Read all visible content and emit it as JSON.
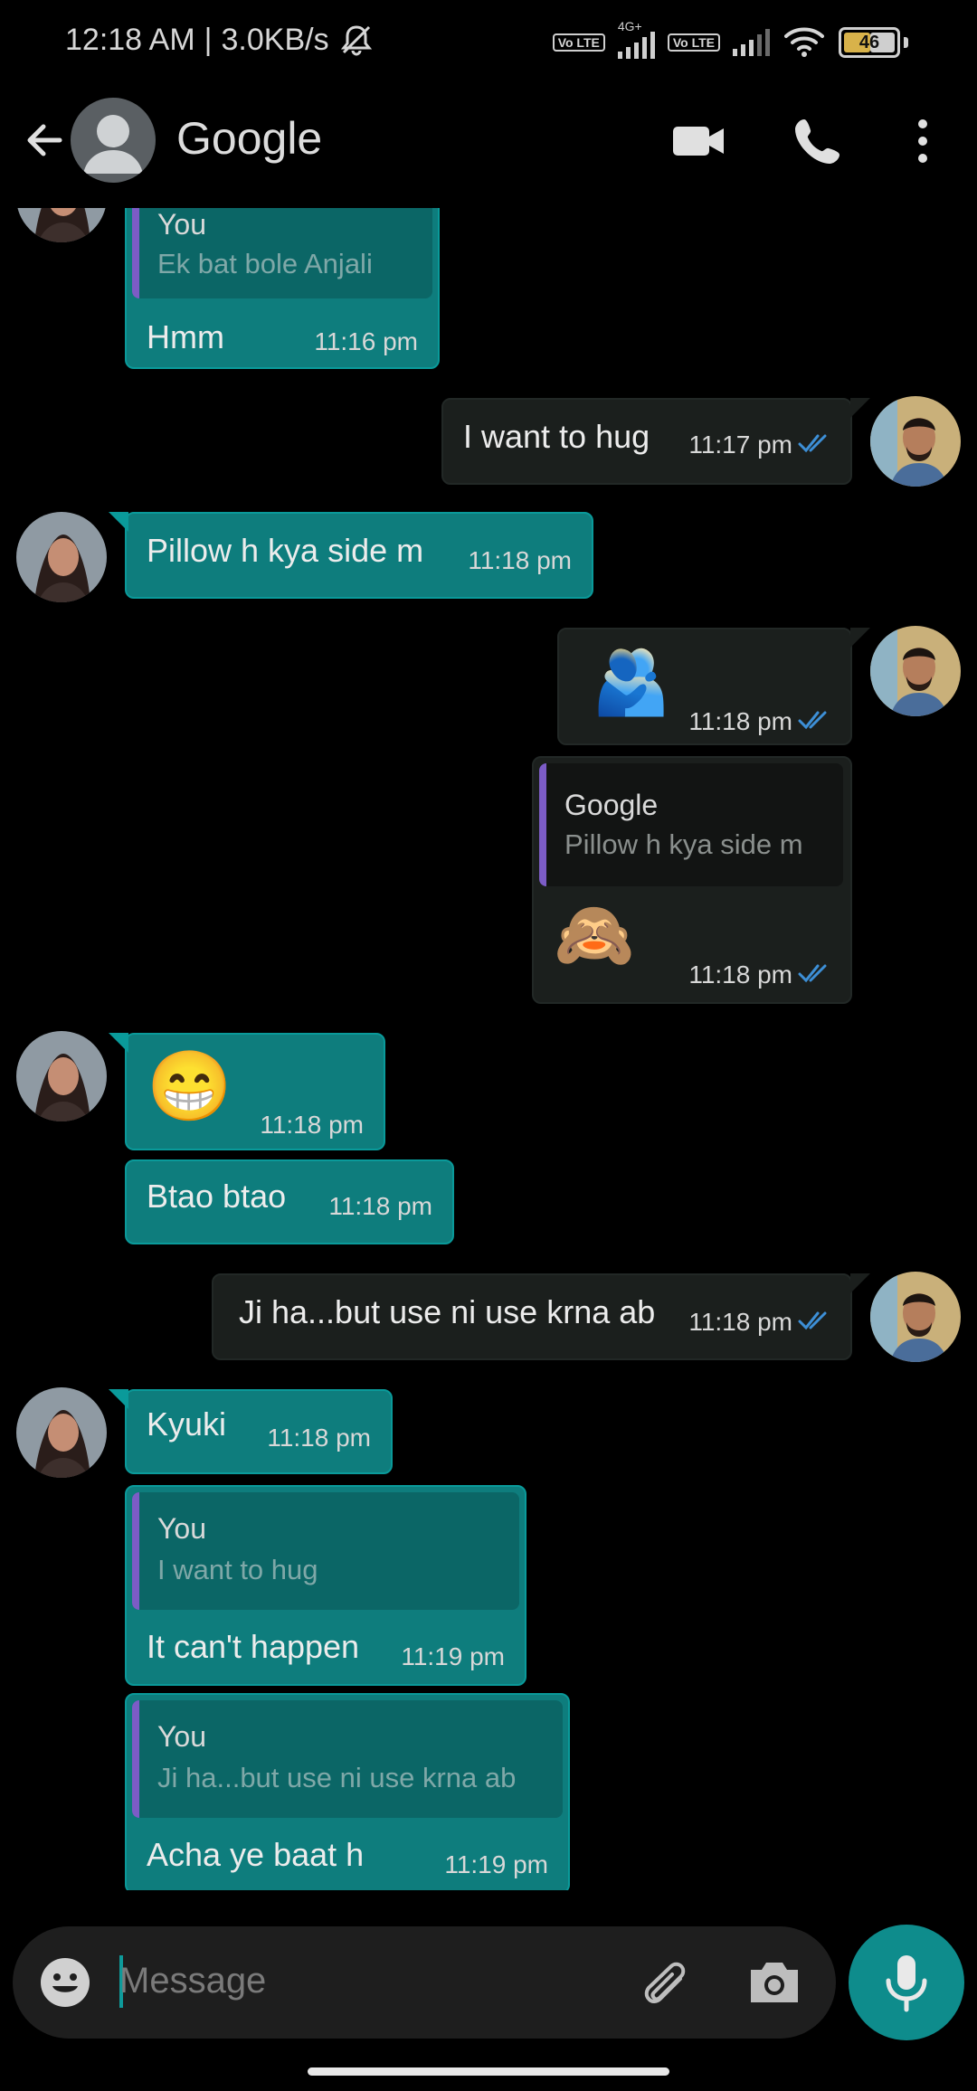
{
  "status": {
    "time": "12:18 AM",
    "speed": "3.0KB/s",
    "sim1_tag": "Vo LTE",
    "network": "4G+",
    "sim2_tag": "Vo LTE",
    "battery": "46"
  },
  "header": {
    "contact_name": "Google"
  },
  "messages": [
    {
      "quote_name": "You",
      "quote_text": "Ek bat bole Anjali",
      "text": "Hmm",
      "time": "11:16 pm"
    },
    {
      "text": "I want to hug",
      "time": "11:17 pm"
    },
    {
      "text": "Pillow h kya side m",
      "time": "11:18 pm"
    },
    {
      "emoji": "🫂",
      "time": "11:18 pm"
    },
    {
      "quote_name": "Google",
      "quote_text": "Pillow h kya side m",
      "emoji": "🙈",
      "time": "11:18 pm"
    },
    {
      "emoji": "😁",
      "time": "11:18 pm"
    },
    {
      "text": "Btao btao",
      "time": "11:18 pm"
    },
    {
      "text": "Ji ha...but use ni use krna ab",
      "time": "11:18 pm"
    },
    {
      "text": "Kyuki",
      "time": "11:18 pm"
    },
    {
      "quote_name": "You",
      "quote_text": "I want to hug",
      "text": "It can't happen",
      "time": "11:19 pm"
    },
    {
      "quote_name": "You",
      "quote_text": "Ji ha...but use ni use krna ab",
      "text": "Acha ye baat h",
      "time": "11:19 pm"
    }
  ],
  "composer": {
    "placeholder": "Message"
  },
  "colors": {
    "incoming_bubble": "#0e7d7d",
    "outgoing_bubble": "#1b1f1d",
    "read_ticks": "#3d8fd6",
    "quote_bar": "#7c5cc6",
    "mic_button": "#0e8c8c"
  }
}
